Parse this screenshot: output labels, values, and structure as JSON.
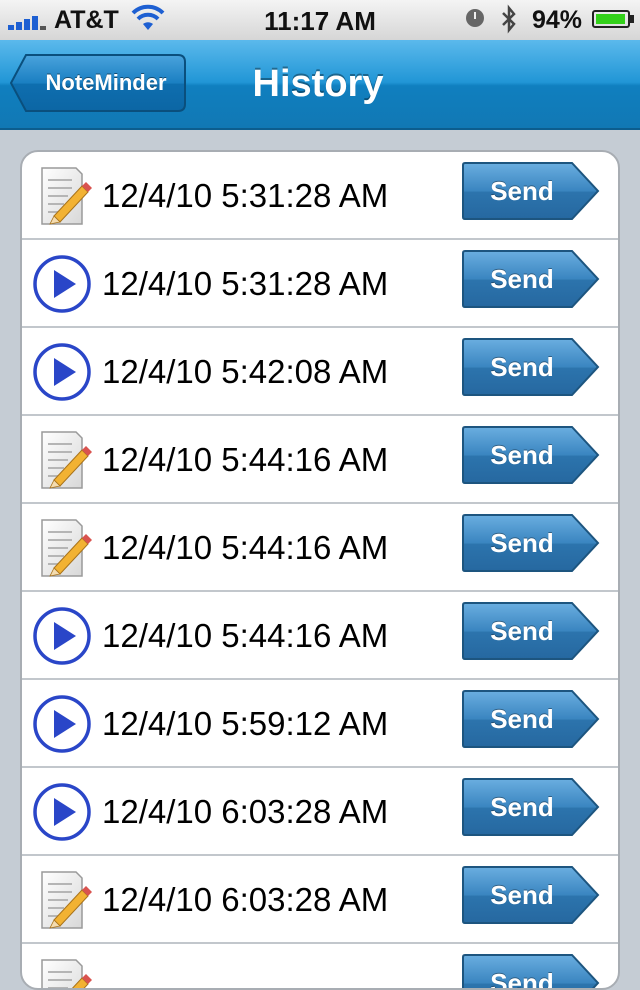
{
  "status_bar": {
    "carrier": "AT&T",
    "time": "11:17 AM",
    "battery_percent": "94%",
    "battery_level": 0.94,
    "signal_bars": 5
  },
  "nav": {
    "back_label": "NoteMinder",
    "title": "History"
  },
  "colors": {
    "nav_blue": "#2196d6",
    "send_blue": "#2e7ab3",
    "play_blue": "#2a46c8"
  },
  "history": [
    {
      "type": "note-icon",
      "time": "12/4/10 5:31:28 AM",
      "action": "Send"
    },
    {
      "type": "play-icon",
      "time": "12/4/10 5:31:28 AM",
      "action": "Send"
    },
    {
      "type": "play-icon",
      "time": "12/4/10 5:42:08 AM",
      "action": "Send"
    },
    {
      "type": "note-icon",
      "time": "12/4/10 5:44:16 AM",
      "action": "Send"
    },
    {
      "type": "note-icon",
      "time": "12/4/10 5:44:16 AM",
      "action": "Send"
    },
    {
      "type": "play-icon",
      "time": "12/4/10 5:44:16 AM",
      "action": "Send"
    },
    {
      "type": "play-icon",
      "time": "12/4/10 5:59:12 AM",
      "action": "Send"
    },
    {
      "type": "play-icon",
      "time": "12/4/10 6:03:28 AM",
      "action": "Send"
    },
    {
      "type": "note-icon",
      "time": "12/4/10 6:03:28 AM",
      "action": "Send"
    },
    {
      "type": "note-icon",
      "time": "",
      "action": "Send"
    }
  ]
}
